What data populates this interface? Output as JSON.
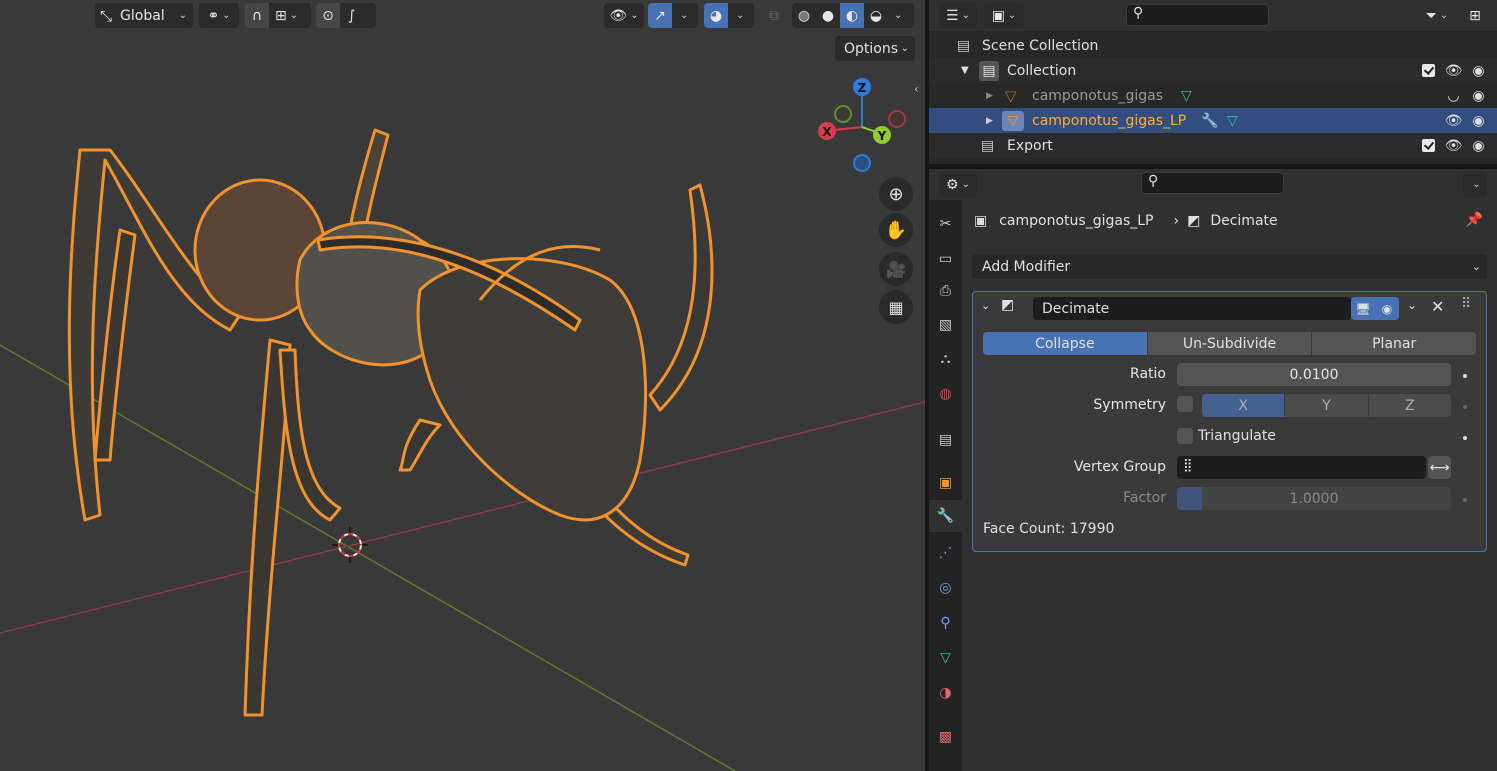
{
  "viewport": {
    "orientation_label": "Global",
    "options_label": "Options",
    "gizmo": {
      "x": "X",
      "y": "Y",
      "z": "Z"
    },
    "colors": {
      "background": "#393939",
      "selection_outline": "#f0922e",
      "x_axis": "#d93b4a",
      "y_axis": "#8fcc2d",
      "z_axis": "#2f7be0"
    }
  },
  "outliner": {
    "rows": [
      {
        "label": "Scene Collection"
      },
      {
        "label": "Collection"
      },
      {
        "label": "camponotus_gigas"
      },
      {
        "label": "camponotus_gigas_LP"
      },
      {
        "label": "Export"
      }
    ]
  },
  "properties": {
    "breadcrumb": {
      "object": "camponotus_gigas_LP",
      "modifier": "Decimate"
    },
    "add_modifier_label": "Add Modifier",
    "modifier": {
      "name": "Decimate",
      "modes": [
        "Collapse",
        "Un-Subdivide",
        "Planar"
      ],
      "active_mode": "Collapse",
      "ratio_label": "Ratio",
      "ratio_value": "0.0100",
      "symmetry_label": "Symmetry",
      "symmetry_axes": [
        "X",
        "Y",
        "Z"
      ],
      "triangulate_label": "Triangulate",
      "vertex_group_label": "Vertex Group",
      "factor_label": "Factor",
      "factor_value": "1.0000",
      "face_count_label": "Face Count: 17990"
    }
  }
}
